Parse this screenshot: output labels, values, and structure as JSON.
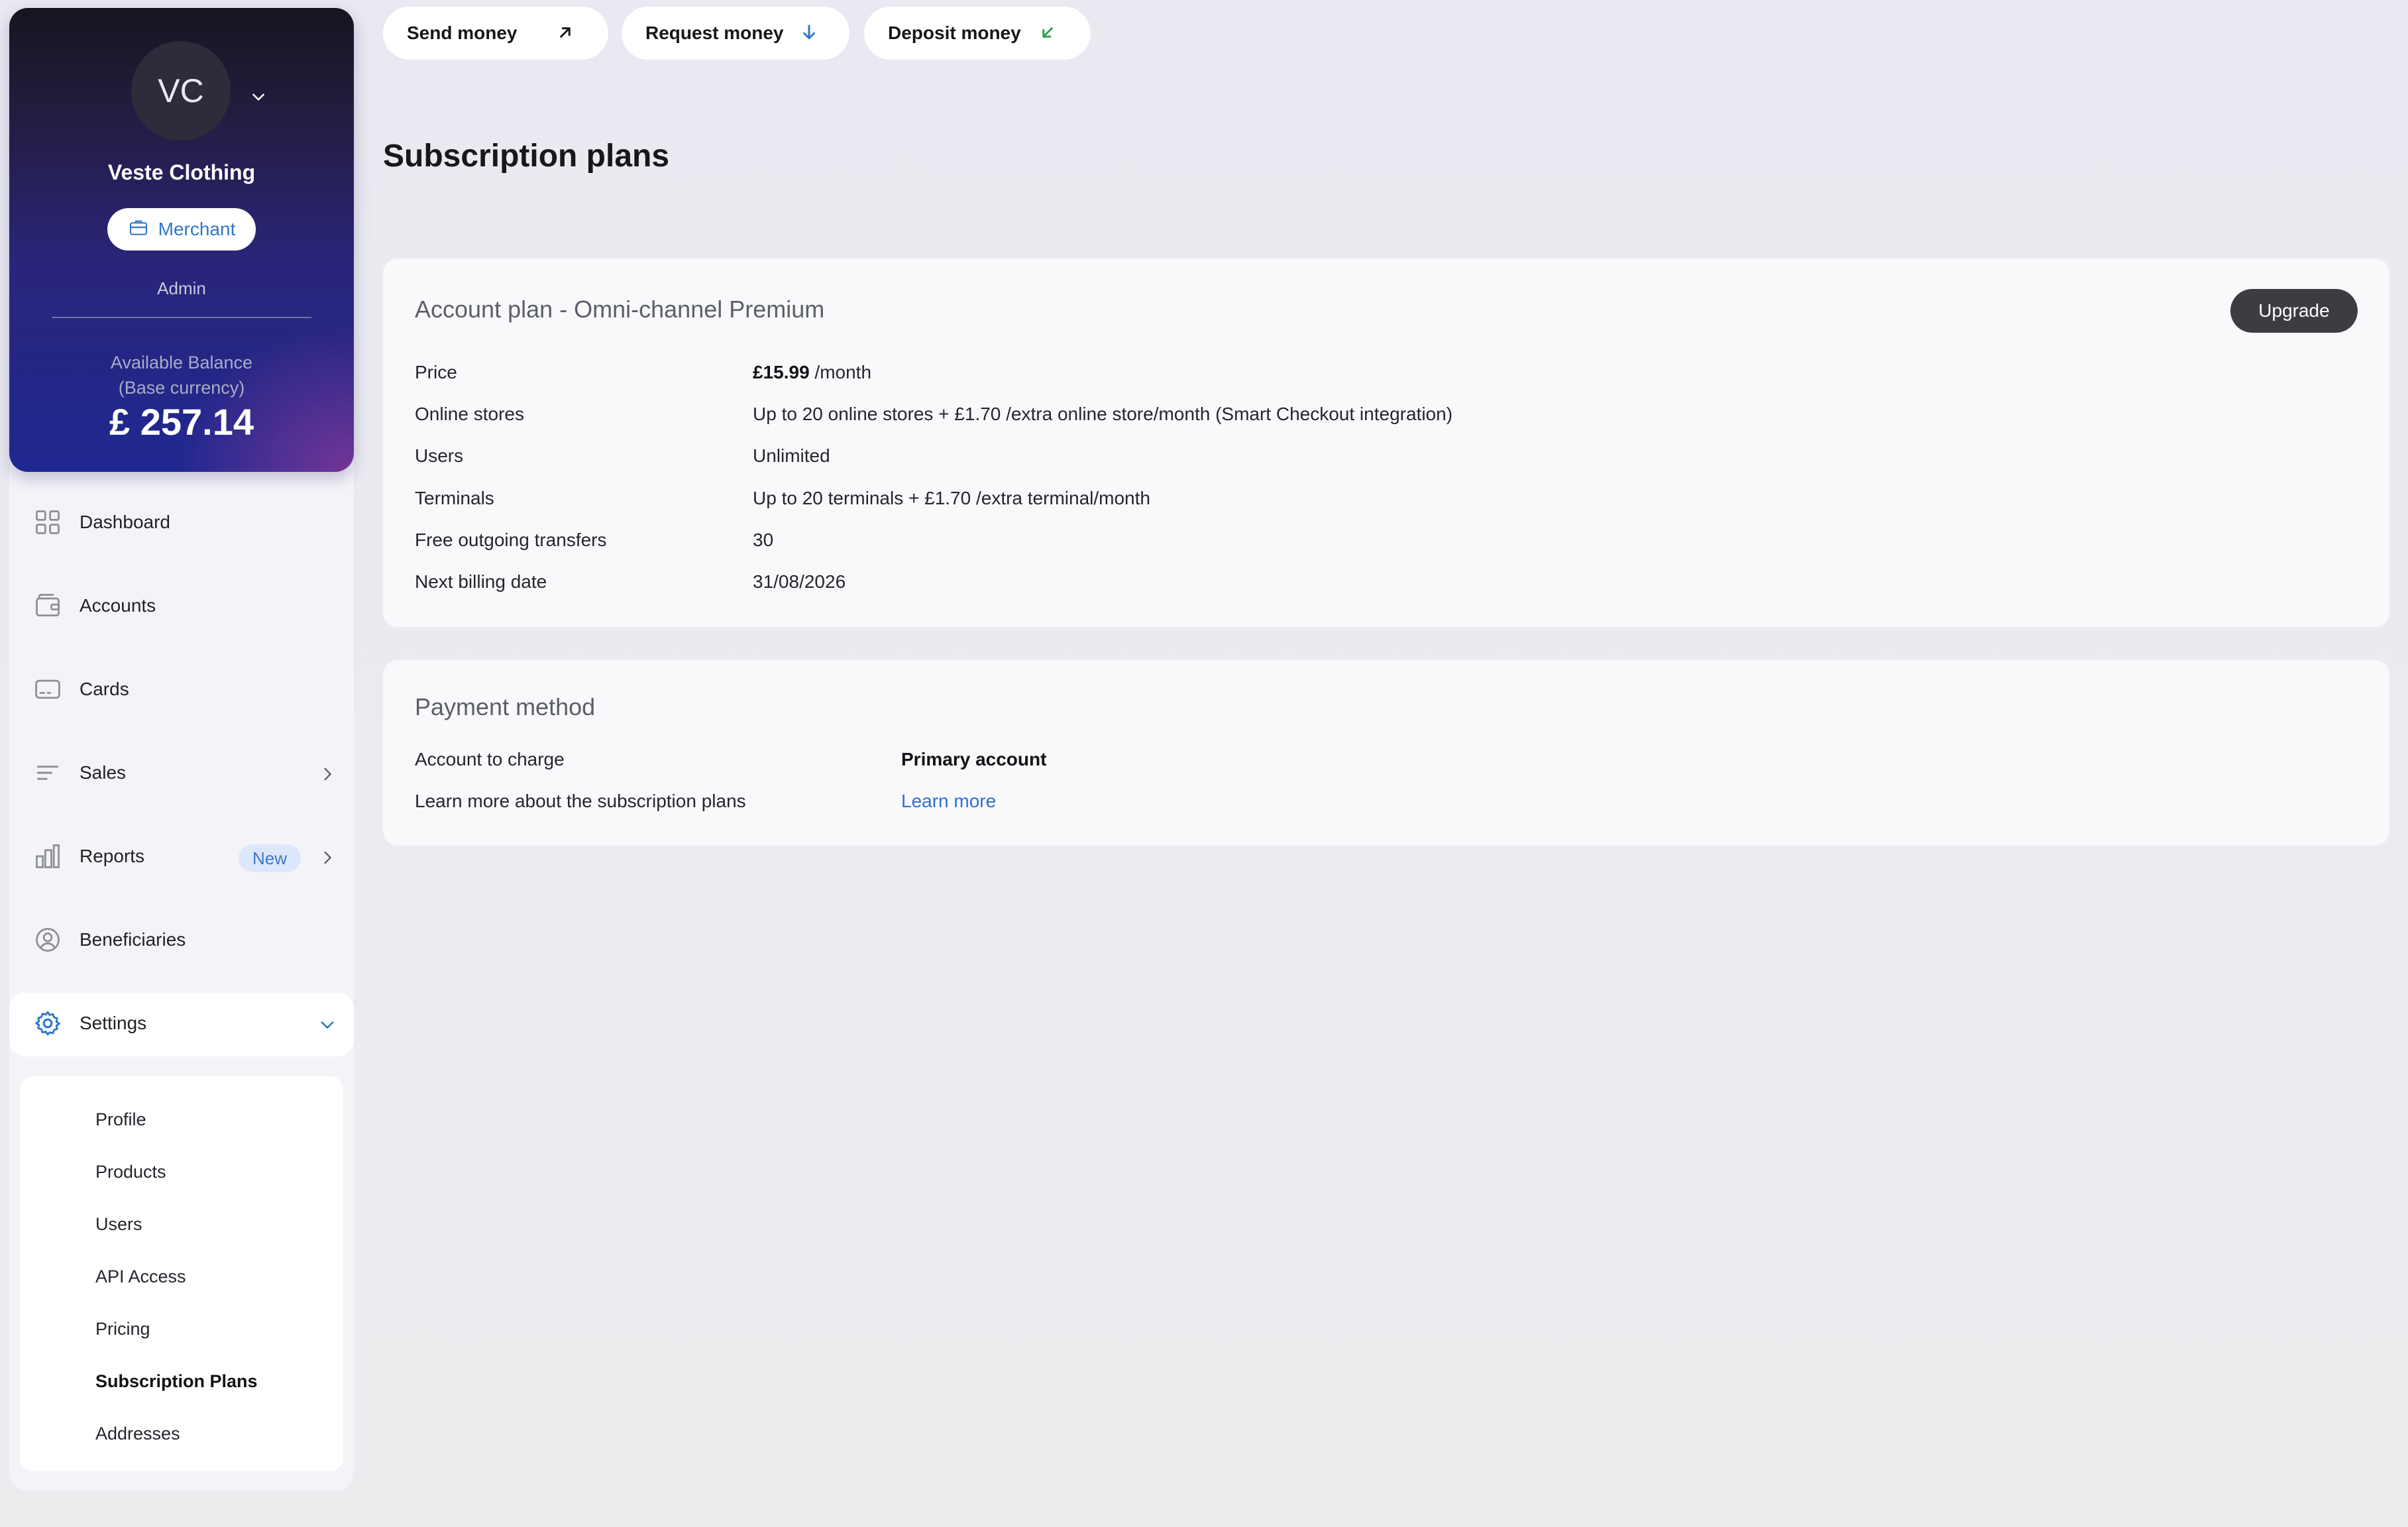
{
  "top_actions": {
    "send": "Send money",
    "request": "Request money",
    "deposit": "Deposit money"
  },
  "sidebar": {
    "avatar_initials": "VC",
    "company_name": "Veste Clothing",
    "merchant_label": "Merchant",
    "role": "Admin",
    "balance_label_line1": "Available Balance",
    "balance_label_line2": "(Base currency)",
    "balance_amount": "£ 257.14",
    "nav": {
      "dashboard": "Dashboard",
      "accounts": "Accounts",
      "cards": "Cards",
      "sales": "Sales",
      "reports": "Reports",
      "reports_badge": "New",
      "beneficiaries": "Beneficiaries",
      "settings": "Settings"
    },
    "settings_submenu": [
      "Profile",
      "Products",
      "Users",
      "API Access",
      "Pricing",
      "Subscription Plans",
      "Addresses"
    ]
  },
  "main": {
    "page_title": "Subscription plans",
    "account_plan": {
      "title": "Account plan - Omni-channel Premium",
      "upgrade_label": "Upgrade",
      "rows": [
        {
          "label": "Price",
          "value_bold": "£15.99",
          "value": " /month"
        },
        {
          "label": "Online stores",
          "value": "Up to 20 online stores + £1.70 /extra online store/month (Smart Checkout integration)"
        },
        {
          "label": "Users",
          "value": "Unlimited"
        },
        {
          "label": "Terminals",
          "value": "Up to 20 terminals + £1.70 /extra terminal/month"
        },
        {
          "label": "Free outgoing transfers",
          "value": "30"
        },
        {
          "label": "Next billing date",
          "value": "31/08/2026"
        }
      ]
    },
    "payment_method": {
      "title": "Payment method",
      "rows": [
        {
          "label": "Account to charge",
          "value": "Primary account"
        },
        {
          "label": "Learn more about the subscription plans",
          "value": "Learn more"
        }
      ]
    }
  },
  "colors": {
    "accent_blue": "#2f79c9",
    "link_blue": "#2f6fd1",
    "deposit_green": "#2aa34a",
    "upgrade_dark": "#3b3d42"
  }
}
